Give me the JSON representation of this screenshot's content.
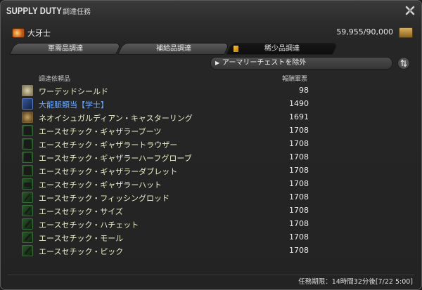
{
  "window": {
    "title": "SUPPLY DUTY",
    "subtitle": "調達任務"
  },
  "header": {
    "company_name": "大牙士",
    "company_icon": "grand-company-crest-icon",
    "seals": "59,955/90,000",
    "seal_icon": "company-seal-icon"
  },
  "tabs": [
    {
      "label": "軍需品調達",
      "active": false
    },
    {
      "label": "補給品調達",
      "active": false
    },
    {
      "label": "稀少品調達",
      "active": true
    }
  ],
  "filter": {
    "label": "アーマリーチェストを除外"
  },
  "columns": {
    "item": "調達依頼品",
    "reward": "報酬軍票"
  },
  "items": [
    {
      "name": "ワーデッドシールド",
      "reward": "98",
      "icon": "shield-icon"
    },
    {
      "name": "大龍脈類当【学士】",
      "reward": "1490",
      "icon": "book-icon",
      "highlight": true
    },
    {
      "name": "ネオイシュガルディアン・キャスターリング",
      "reward": "1691",
      "icon": "ring-icon"
    },
    {
      "name": "エースセチック・ギャザラーブーツ",
      "reward": "1708",
      "icon": "boots-icon"
    },
    {
      "name": "エースセチック・ギャザラートラウザー",
      "reward": "1708",
      "icon": "trousers-icon"
    },
    {
      "name": "エースセチック・ギャザラーハーフグローブ",
      "reward": "1708",
      "icon": "gloves-icon"
    },
    {
      "name": "エースセチック・ギャザラーダブレット",
      "reward": "1708",
      "icon": "doublet-icon"
    },
    {
      "name": "エースセチック・ギャザラーハット",
      "reward": "1708",
      "icon": "hat-icon"
    },
    {
      "name": "エースセチック・フィッシングロッド",
      "reward": "1708",
      "icon": "fishing-rod-icon"
    },
    {
      "name": "エースセチック・サイズ",
      "reward": "1708",
      "icon": "scythe-icon"
    },
    {
      "name": "エースセチック・ハチェット",
      "reward": "1708",
      "icon": "hatchet-icon"
    },
    {
      "name": "エースセチック・モール",
      "reward": "1708",
      "icon": "maul-icon"
    },
    {
      "name": "エースセチック・ピック",
      "reward": "1708",
      "icon": "pickaxe-icon"
    }
  ],
  "footer": {
    "deadline": "任務期限：14時間32分後[7/22 5:00]"
  },
  "colors": {
    "item_text": "#e8f0c8",
    "highlight_text": "#6aa8ff"
  }
}
